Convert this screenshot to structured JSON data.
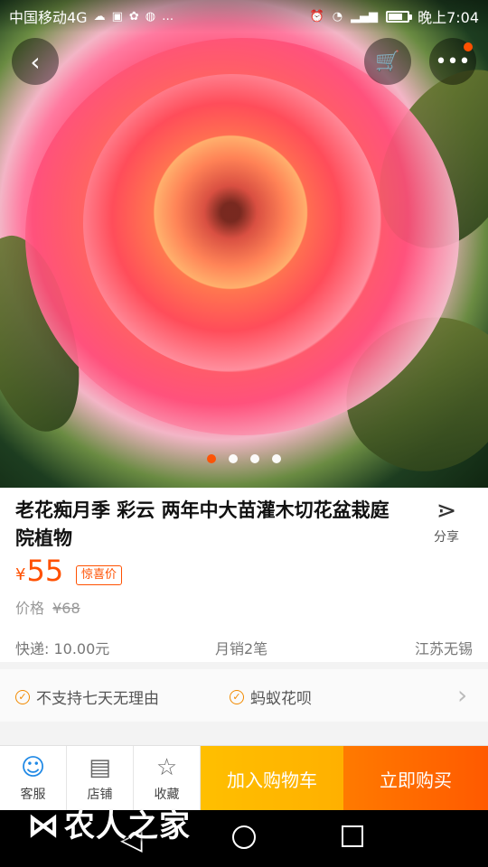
{
  "status_bar": {
    "carrier": "中国移动4G",
    "time": "晚上7:04",
    "icons": [
      "cloud-icon",
      "app-icon",
      "paw-icon",
      "baidu-icon",
      "ellipsis-icon",
      "alarm-icon",
      "wifi-icon",
      "signal-icon",
      "battery-icon"
    ]
  },
  "hero": {
    "carousel_dots": 4,
    "active_dot": 0
  },
  "product": {
    "title": "老花痴月季 彩云 两年中大苗灌木切花盆栽庭院植物",
    "share_label": "分享",
    "currency": "¥",
    "price": "55",
    "price_tag": "惊喜价",
    "original_price_label": "价格",
    "original_price": "¥68",
    "shipping": "快递: 10.00元",
    "monthly_sales": "月销2笔",
    "location": "江苏无锡"
  },
  "guarantees": {
    "item1": "不支持七天无理由",
    "item2": "蚂蚁花呗"
  },
  "bottom_bar": {
    "service": "客服",
    "shop": "店铺",
    "favorite": "收藏",
    "add_to_cart": "加入购物车",
    "buy_now": "立即购买"
  },
  "watermark": {
    "text": "农人之家"
  },
  "colors": {
    "accent": "#ff5000",
    "cart_button": "#ffb000",
    "buy_button": "#ff6a00",
    "service_icon": "#1e88e5"
  }
}
